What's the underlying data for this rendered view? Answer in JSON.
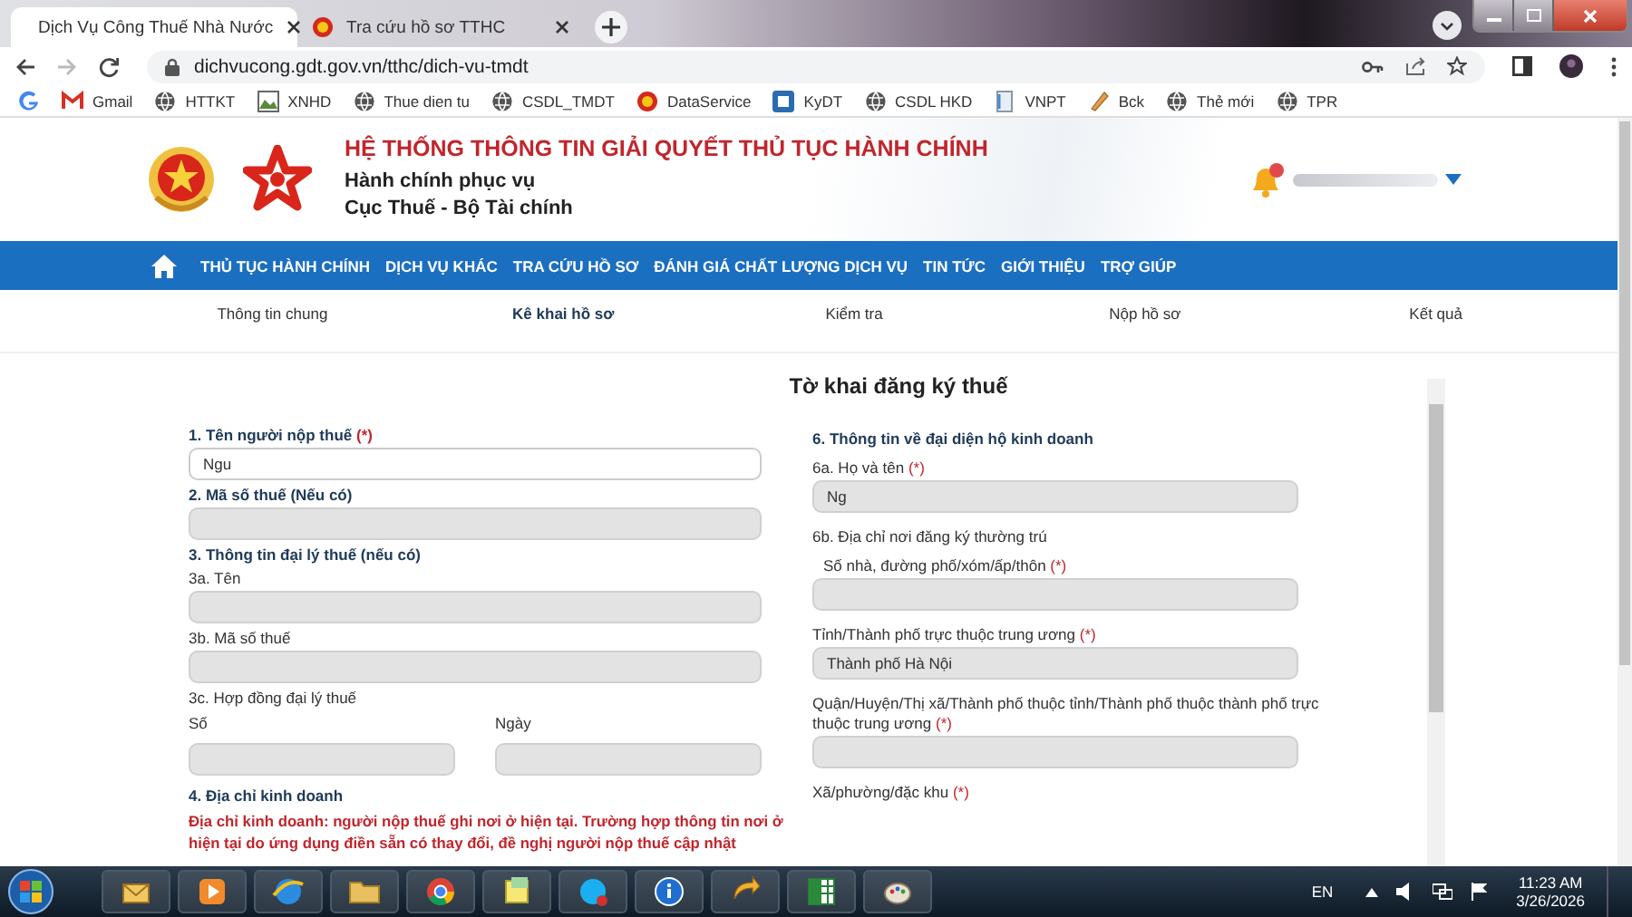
{
  "browser": {
    "tabs": [
      {
        "title": "Dịch Vụ Công Thuế Nhà Nước",
        "selected": true
      },
      {
        "title": "Tra cứu hồ sơ TTHC",
        "selected": false
      }
    ],
    "url": "dichvucong.gdt.gov.vn/tthc/dich-vu-tmdt",
    "bookmarks": [
      {
        "kind": "google"
      },
      {
        "kind": "gmail",
        "label": "Gmail"
      },
      {
        "kind": "globe",
        "label": "HTTKT"
      },
      {
        "kind": "image",
        "label": "XNHD"
      },
      {
        "kind": "globe",
        "label": "Thue dien tu"
      },
      {
        "kind": "globe",
        "label": "CSDL_TMDT"
      },
      {
        "kind": "emblem",
        "label": "DataService"
      },
      {
        "kind": "app",
        "label": "KyDT"
      },
      {
        "kind": "globe",
        "label": "CSDL HKD"
      },
      {
        "kind": "doc",
        "label": "VNPT"
      },
      {
        "kind": "pen",
        "label": "Bck"
      },
      {
        "kind": "globe",
        "label": "Thẻ mới"
      },
      {
        "kind": "globe",
        "label": "TPR"
      }
    ]
  },
  "header": {
    "title": "HỆ THỐNG THÔNG TIN GIẢI QUYẾT THỦ TỤC HÀNH CHÍNH",
    "subtitles": [
      "Hành chính phục vụ",
      "Cục Thuế - Bộ Tài chính"
    ]
  },
  "nav": [
    "THỦ TỤC HÀNH CHÍNH",
    "DỊCH VỤ KHÁC",
    "TRA CỨU HỒ SƠ",
    "ĐÁNH GIÁ CHẤT LƯỢNG DỊCH VỤ",
    "TIN TỨC",
    "GIỚI THIỆU",
    "TRỢ GIÚP"
  ],
  "steps": [
    {
      "label": "Thông tin chung",
      "selected": false
    },
    {
      "label": "Kê khai hồ sơ",
      "selected": true
    },
    {
      "label": "Kiểm tra",
      "selected": false
    },
    {
      "label": "Nộp hồ sơ",
      "selected": false
    },
    {
      "label": "Kết quả",
      "selected": false
    }
  ],
  "form": {
    "title": "Tờ khai đăng ký thuế",
    "left": [
      {
        "kind": "heading",
        "text": "1. Tên người nộp thuế",
        "mark": "(*)"
      },
      {
        "kind": "field",
        "value": "Ngu",
        "disabled": false
      },
      {
        "kind": "heading",
        "text": "2. Mã số thuế (Nếu có)"
      },
      {
        "kind": "field",
        "disabled": true
      },
      {
        "kind": "heading",
        "text": "3. Thông tin đại lý thuế (nếu có)"
      },
      {
        "kind": "label",
        "text": "3a. Tên"
      },
      {
        "kind": "field",
        "disabled": true
      },
      {
        "kind": "label",
        "text": "3b. Mã số thuế"
      },
      {
        "kind": "field",
        "disabled": true
      },
      {
        "kind": "label",
        "text": "3c. Hợp đồng đại lý thuế"
      },
      {
        "kind": "pair",
        "parts": [
          {
            "label": "Số",
            "disabled": true
          },
          {
            "label": "Ngày",
            "disabled": true
          }
        ]
      },
      {
        "kind": "heading",
        "text": "4. Địa chỉ kinh doanh"
      },
      {
        "kind": "note",
        "text": "Địa chỉ kinh doanh: người nộp thuế ghi nơi ở hiện tại. Trường hợp thông tin nơi ở hiện tại do ứng dụng điền sẵn có thay đổi, đề nghị người nộp thuế cập nhật"
      }
    ],
    "right": [
      {
        "kind": "heading",
        "text": "6. Thông tin về đại diện hộ kinh doanh"
      },
      {
        "kind": "label",
        "text": "6a. Họ và tên",
        "mark": "(*)"
      },
      {
        "kind": "field",
        "value": "Ng",
        "disabled": true
      },
      {
        "kind": "label",
        "text": "6b. Địa chỉ nơi đăng ký thường trú"
      },
      {
        "kind": "sublabel",
        "text": "Số nhà, đường phố/xóm/ấp/thôn",
        "mark": "(*)"
      },
      {
        "kind": "field",
        "disabled": true
      },
      {
        "kind": "label",
        "text": "Tỉnh/Thành phố trực thuộc trung ương",
        "mark": "(*)"
      },
      {
        "kind": "field",
        "value": "Thành phố Hà Nội",
        "disabled": true
      },
      {
        "kind": "label",
        "text": "Quận/Huyện/Thị xã/Thành phố thuộc tỉnh/Thành phố thuộc thành phố trực thuộc trung ương",
        "mark": "(*)"
      },
      {
        "kind": "field",
        "disabled": true
      },
      {
        "kind": "label",
        "text": "Xã/phường/đặc khu",
        "mark": "(*)"
      }
    ]
  },
  "taskbar": {
    "apps": [
      {
        "kind": "mail"
      },
      {
        "kind": "media"
      },
      {
        "kind": "ie"
      },
      {
        "kind": "folder"
      },
      {
        "kind": "chrome"
      },
      {
        "kind": "notes"
      },
      {
        "kind": "skype"
      },
      {
        "kind": "info"
      },
      {
        "kind": "sync"
      },
      {
        "kind": "excel"
      },
      {
        "kind": "paint"
      }
    ],
    "language": "EN",
    "time": "11:23 AM",
    "date": "3/26/2026"
  }
}
